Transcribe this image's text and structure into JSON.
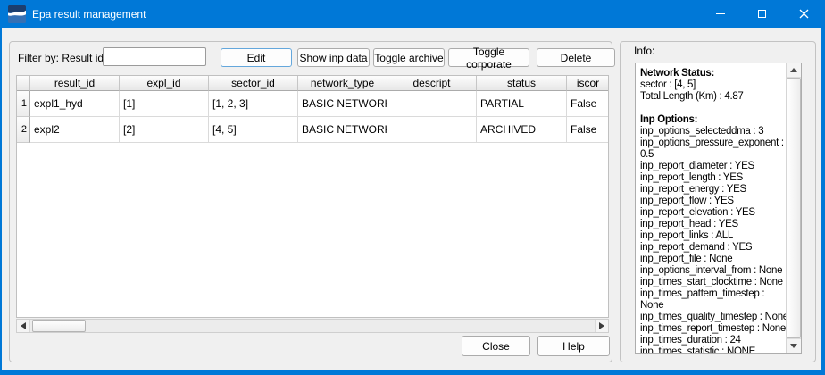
{
  "window": {
    "title": "Epa result management",
    "accent_color": "#0078d7"
  },
  "toolbar": {
    "filter_label": "Filter by: Result id",
    "filter_value": "",
    "filter_placeholder": "",
    "buttons": [
      "Edit",
      "Show inp data",
      "Toggle archive",
      "Toggle corporate",
      "Delete"
    ]
  },
  "table": {
    "headers": [
      "result_id",
      "expl_id",
      "sector_id",
      "network_type",
      "descript",
      "status",
      "iscor"
    ],
    "rows": [
      {
        "num": "1",
        "cells": [
          "expl1_hyd",
          "[1]",
          "[1, 2, 3]",
          "BASIC NETWORK",
          "",
          "PARTIAL",
          "False"
        ]
      },
      {
        "num": "2",
        "cells": [
          "expl2",
          "[2]",
          "[4, 5]",
          "BASIC NETWORK",
          "",
          "ARCHIVED",
          "False"
        ]
      }
    ]
  },
  "info": {
    "label": "Info:",
    "lines": [
      {
        "text": "Network Status:",
        "bold": true
      },
      {
        "text": "sector : [4, 5]",
        "bold": false
      },
      {
        "text": "Total Length (Km) : 4.87",
        "bold": false
      },
      {
        "text": "",
        "bold": false
      },
      {
        "text": "Inp Options:",
        "bold": true
      },
      {
        "text": "inp_options_selecteddma : 3",
        "bold": false
      },
      {
        "text": "inp_options_pressure_exponent :",
        "bold": false
      },
      {
        "text": "0.5",
        "bold": false
      },
      {
        "text": "inp_report_diameter : YES",
        "bold": false
      },
      {
        "text": "inp_report_length : YES",
        "bold": false
      },
      {
        "text": "inp_report_energy : YES",
        "bold": false
      },
      {
        "text": "inp_report_flow : YES",
        "bold": false
      },
      {
        "text": "inp_report_elevation : YES",
        "bold": false
      },
      {
        "text": "inp_report_head : YES",
        "bold": false
      },
      {
        "text": "inp_report_links : ALL",
        "bold": false
      },
      {
        "text": "inp_report_demand : YES",
        "bold": false
      },
      {
        "text": "inp_report_file : None",
        "bold": false
      },
      {
        "text": "inp_options_interval_from : None",
        "bold": false
      },
      {
        "text": "inp_times_start_clocktime : None",
        "bold": false
      },
      {
        "text": "inp_times_pattern_timestep :",
        "bold": false
      },
      {
        "text": "None",
        "bold": false
      },
      {
        "text": "inp_times_quality_timestep : None",
        "bold": false
      },
      {
        "text": "inp_times_report_timestep : None",
        "bold": false
      },
      {
        "text": "inp_times_duration : 24",
        "bold": false
      },
      {
        "text": "inp_times_statistic : NONE",
        "bold": false
      }
    ]
  },
  "footer": {
    "close": "Close",
    "help": "Help"
  }
}
